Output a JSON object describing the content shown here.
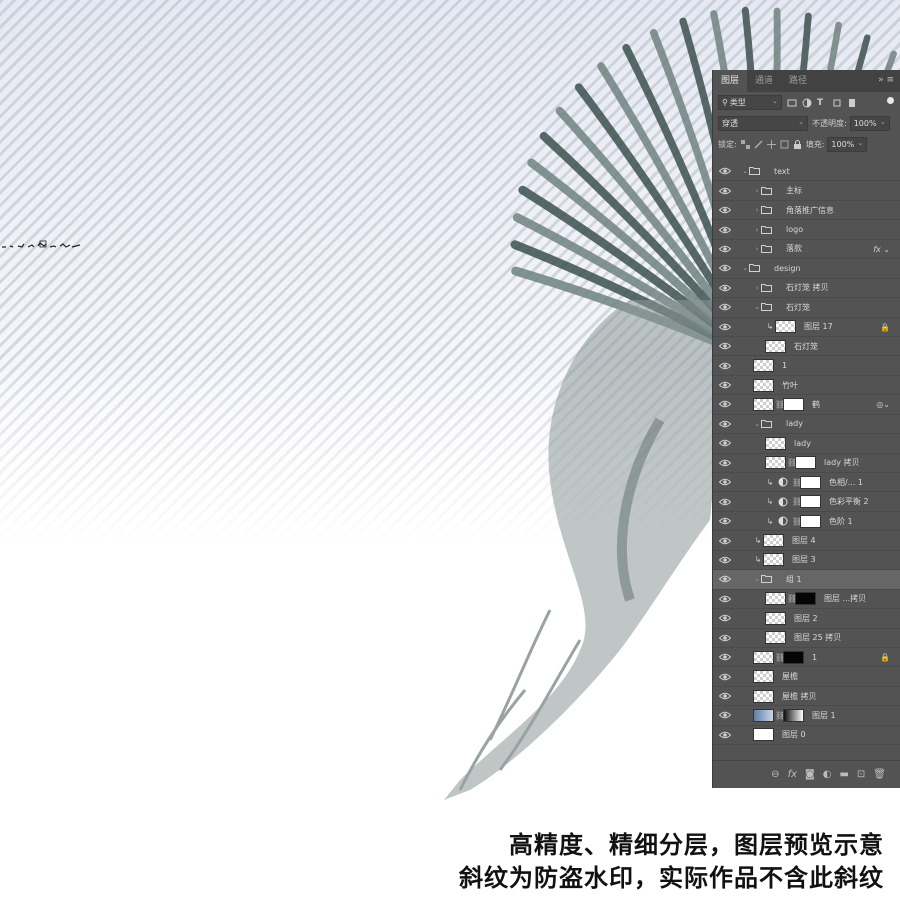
{
  "panel": {
    "tabs": [
      "图层",
      "通道",
      "路径"
    ],
    "filter_label": "类型",
    "blend_mode": "穿透",
    "opacity_label": "不透明度:",
    "opacity_value": "100%",
    "lock_label": "锁定:",
    "fill_label": "填充:",
    "fill_value": "100%"
  },
  "layers": [
    {
      "name": "text",
      "kind": "group",
      "indent": 0,
      "expanded": true
    },
    {
      "name": "主标",
      "kind": "group",
      "indent": 1
    },
    {
      "name": "角落推广信息",
      "kind": "group",
      "indent": 1
    },
    {
      "name": "logo",
      "kind": "group",
      "indent": 1
    },
    {
      "name": "落款",
      "kind": "group",
      "indent": 1,
      "fx": true
    },
    {
      "name": "design",
      "kind": "group",
      "indent": 0,
      "expanded": true
    },
    {
      "name": "石灯笼 拷贝",
      "kind": "group",
      "indent": 1
    },
    {
      "name": "石灯笼",
      "kind": "group",
      "indent": 1,
      "expanded": true
    },
    {
      "name": "图层 17",
      "kind": "layer",
      "indent": 2,
      "clip": true,
      "lock": true
    },
    {
      "name": "石灯笼",
      "kind": "layer",
      "indent": 2
    },
    {
      "name": "1",
      "kind": "layer",
      "indent": 1
    },
    {
      "name": "竹叶",
      "kind": "layer",
      "indent": 1
    },
    {
      "name": "鹤",
      "kind": "smart",
      "indent": 1
    },
    {
      "name": "lady",
      "kind": "group",
      "indent": 1,
      "expanded": true
    },
    {
      "name": "lady",
      "kind": "layer",
      "indent": 2
    },
    {
      "name": "lady 拷贝",
      "kind": "masked",
      "indent": 2,
      "mask": "white"
    },
    {
      "name": "色相/... 1",
      "kind": "adjust",
      "indent": 2
    },
    {
      "name": "色彩平衡 2",
      "kind": "adjust",
      "indent": 2
    },
    {
      "name": "色阶 1",
      "kind": "adjust",
      "indent": 2
    },
    {
      "name": "图层 4",
      "kind": "layer",
      "indent": 1,
      "clip": true
    },
    {
      "name": "图层 3",
      "kind": "layer",
      "indent": 1,
      "clip": true
    },
    {
      "name": "组 1",
      "kind": "group",
      "indent": 1,
      "expanded": true,
      "highlight": true
    },
    {
      "name": "图层 ...拷贝",
      "kind": "masked",
      "indent": 2,
      "mask": "black"
    },
    {
      "name": "图层 2",
      "kind": "layer",
      "indent": 2
    },
    {
      "name": "图层 25 拷贝",
      "kind": "layer",
      "indent": 2
    },
    {
      "name": "1",
      "kind": "masked",
      "indent": 1,
      "mask": "black",
      "lock": true
    },
    {
      "name": "屋檐",
      "kind": "layer",
      "indent": 1
    },
    {
      "name": "屋檐 拷贝",
      "kind": "layer",
      "indent": 1
    },
    {
      "name": "图层 1",
      "kind": "masked",
      "indent": 1,
      "mask": "grad",
      "thumb": "sky"
    },
    {
      "name": "图层 0",
      "kind": "layer",
      "indent": 1,
      "thumb": "white"
    }
  ],
  "caption": {
    "line1": "高精度、精细分层，图层预览示意",
    "line2": "斜纹为防盗水印，实际作品不含此斜纹"
  }
}
